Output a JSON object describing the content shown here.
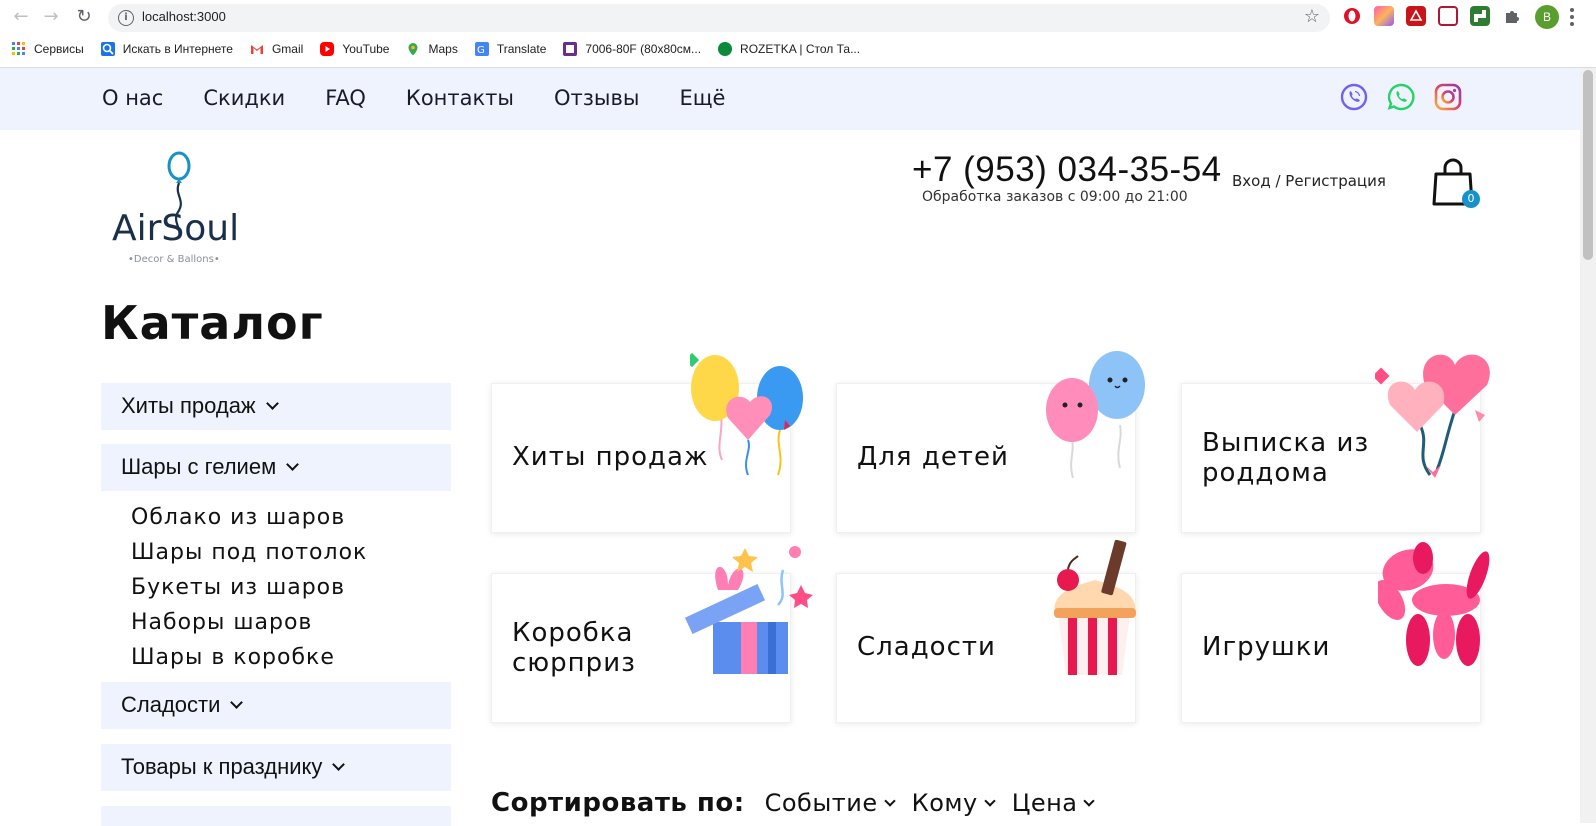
{
  "browser": {
    "url": "localhost:3000",
    "avatar_letter": "B",
    "bookmarks": [
      {
        "label": "Сервисы",
        "icon": "apps-grid-icon",
        "color": "#4285f4"
      },
      {
        "label": "Искать в Интернете",
        "icon": "search-icon",
        "color": "#1a73e8"
      },
      {
        "label": "Gmail",
        "icon": "gmail-icon",
        "color": "#ea4335"
      },
      {
        "label": "YouTube",
        "icon": "youtube-icon",
        "color": "#ff0000"
      },
      {
        "label": "Maps",
        "icon": "maps-pin-icon",
        "color": "#34a853"
      },
      {
        "label": "Translate",
        "icon": "translate-icon",
        "color": "#4285f4"
      },
      {
        "label": "7006-80F (80x80см...",
        "icon": "purple-square-icon",
        "color": "#6a2c91"
      },
      {
        "label": "ROZETKA | Стол Та...",
        "icon": "rozetka-icon",
        "color": "#0a8a3a"
      }
    ]
  },
  "topnav": {
    "items": [
      "О нас",
      "Скидки",
      "FAQ",
      "Контакты",
      "Отзывы",
      "Ещё"
    ]
  },
  "header": {
    "logo_text": "AirSoul",
    "logo_sub": "•Decor & Ballons•",
    "phone": "+7 (953) 034-35-54",
    "hours": "Обработка заказов с 09:00 до 21:00",
    "login": "Вход / Регистрация",
    "cart_count": "0"
  },
  "catalog": {
    "title": "Каталог",
    "sidebar": {
      "hits": "Хиты продаж",
      "helium": "Шары с гелием",
      "sub_items": [
        "Облако из шаров",
        "Шары под потолок",
        "Букеты из шаров",
        "Наборы шаров",
        "Шары в коробке"
      ],
      "sweets": "Сладости",
      "holiday": "Товары к празднику"
    },
    "cards": [
      {
        "lines": [
          "Хиты продаж"
        ],
        "icon": "balloons-icon"
      },
      {
        "lines": [
          "Для детей"
        ],
        "icon": "kids-balloons-icon"
      },
      {
        "lines": [
          "Выписка из",
          "роддома"
        ],
        "icon": "heart-balloons-icon"
      },
      {
        "lines": [
          "Коробка",
          "сюрприз"
        ],
        "icon": "gift-box-icon"
      },
      {
        "lines": [
          "Сладости"
        ],
        "icon": "cupcake-icon"
      },
      {
        "lines": [
          "Игрушки"
        ],
        "icon": "balloon-dog-icon"
      }
    ],
    "sort": {
      "label": "Сортировать по:",
      "options": [
        "Событие",
        "Кому",
        "Цена"
      ]
    }
  },
  "colors": {
    "nav_bg": "#eef3fd",
    "accent": "#1692c9",
    "viber": "#7360f2",
    "whatsapp": "#25d366",
    "instagram": "#e4405f"
  }
}
